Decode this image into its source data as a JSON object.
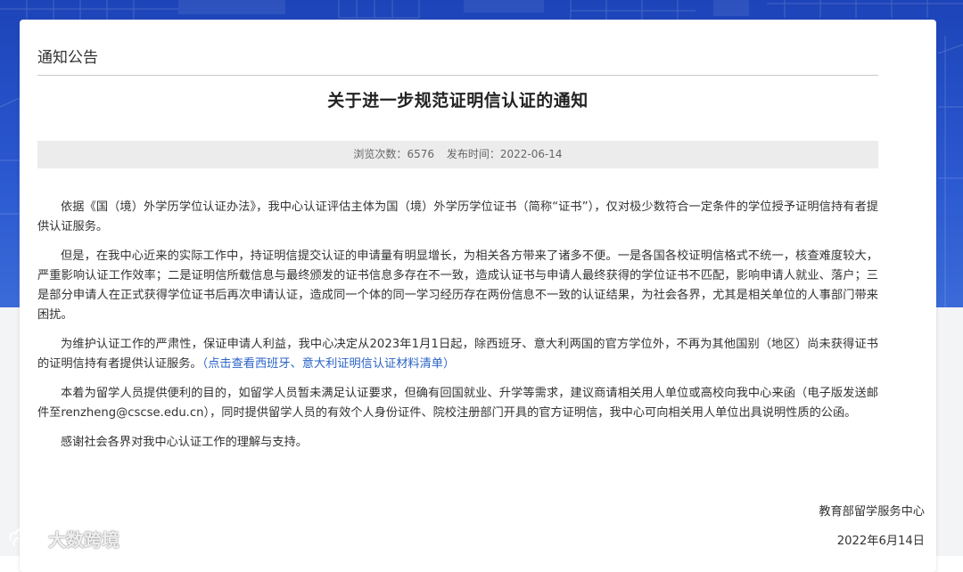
{
  "section": {
    "title": "通知公告"
  },
  "article": {
    "title": "关于进一步规范证明信认证的通知",
    "meta": {
      "views_label": "浏览次数：",
      "views": "6576",
      "date_label": "发布时间：",
      "date": "2022-06-14"
    },
    "paragraphs": {
      "p1": "依据《国（境）外学历学位认证办法》，我中心认证评估主体为国（境）外学历学位证书（简称“证书”），仅对极少数符合一定条件的学位授予证明信持有者提供认证服务。",
      "p2": "但是，在我中心近来的实际工作中，持证明信提交认证的申请量有明显增长，为相关各方带来了诸多不便。一是各国各校证明信格式不统一，核查难度较大，严重影响认证工作效率；二是证明信所载信息与最终颁发的证书信息多存在不一致，造成认证书与申请人最终获得的学位证书不匹配，影响申请人就业、落户；三是部分申请人在正式获得学位证书后再次申请认证，造成同一个体的同一学习经历存在两份信息不一致的认证结果，为社会各界，尤其是相关单位的人事部门带来困扰。",
      "p3": "为维护认证工作的严肃性，保证申请人利益，我中心决定从2023年1月1日起，除西班牙、意大利两国的官方学位外，不再为其他国别（地区）尚未获得证书的证明信持有者提供认证服务。",
      "p3_link": "（点击查看西班牙、意大利证明信认证材料清单）",
      "p4": "本着为留学人员提供便利的目的，如留学人员暂未满足认证要求，但确有回国就业、升学等需求，建议商请相关用人单位或高校向我中心来函（电子版发送邮件至renzheng@cscse.edu.cn），同时提供留学人员的有效个人身份证件、院校注册部门开具的官方证明信，我中心可向相关用人单位出具说明性质的公函。",
      "p5": "感谢社会各界对我中心认证工作的理解与支持。"
    },
    "signature": "教育部留学服务中心",
    "signed_date": "2022年6月14日"
  },
  "watermark": {
    "text": "大数跨境",
    "icon": "cloud-logo-icon"
  },
  "colors": {
    "banner": "#2a57cf",
    "link": "#2b64c8",
    "meta_bg": "#ececec",
    "text": "#333333"
  }
}
